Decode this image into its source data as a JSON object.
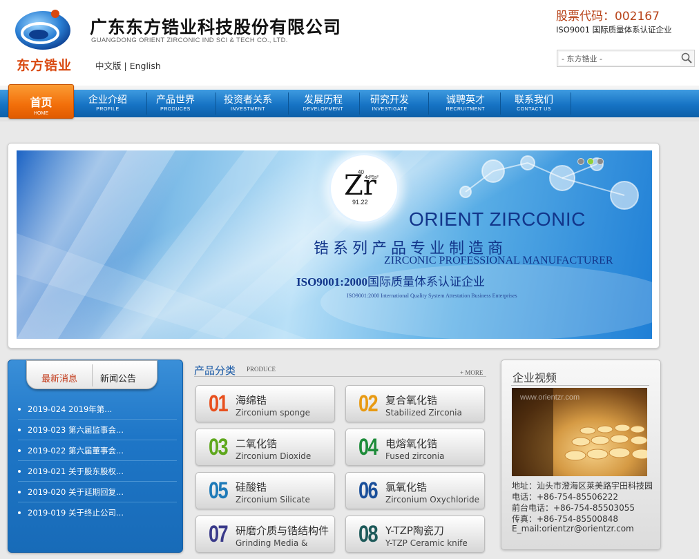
{
  "header": {
    "logo_text": "东方锆业",
    "company_name_cn": "广东东方锆业科技股份有限公司",
    "company_name_en": "GUANGDONG ORIENT ZIRCONIC IND SCI & TECH CO., LTD.",
    "lang_cn": "中文版",
    "lang_sep": "|",
    "lang_en": "English",
    "stock_code": "股票代码：002167",
    "iso_note": "ISO9001 国际质量体系认证企业",
    "search_placeholder": "- 东方锆业 -"
  },
  "nav": {
    "home": {
      "cn": "首页",
      "en": "HOME"
    },
    "items": [
      {
        "cn": "企业介绍",
        "en": "PROFILE"
      },
      {
        "cn": "产品世界",
        "en": "PRODUCES"
      },
      {
        "cn": "投资者关系",
        "en": "INVESTMENT"
      },
      {
        "cn": "发展历程",
        "en": "DEVELOPMENT"
      },
      {
        "cn": "研究开发",
        "en": "INVESTIGATE"
      },
      {
        "cn": "诚聘英才",
        "en": "RECRUITMENT"
      },
      {
        "cn": "联系我们",
        "en": "CONTACT US"
      }
    ]
  },
  "banner": {
    "element_number": "40",
    "element_config": "4d²5s²",
    "element_symbol": "Zr",
    "element_mass": "91.22",
    "brand_en": "ORIENT ZIRCONIC",
    "slogan_cn": "锆系列产品专业制造商",
    "slogan_en": "ZIRCONIC PROFESSIONAL MANUFACTURER",
    "iso_bold": "ISO9001:2000",
    "iso_cn": "国际质量体系认证企业",
    "iso_en": "ISO9001:2000 International Quality System Attestation Business Enterprises",
    "slide_dots": 3,
    "active_slide": 1
  },
  "news": {
    "tabs": [
      "最新消息",
      "新闻公告"
    ],
    "items": [
      "2019-024 2019年第...",
      "2019-023 第六届监事会...",
      "2019-022 第六届董事会...",
      "2019-021 关于股东股权...",
      "2019-020 关于延期回复...",
      "2019-019 关于终止公司..."
    ]
  },
  "products": {
    "title": "产品分类",
    "subtitle": "PRODUCE",
    "more": "+ MORE",
    "items": [
      {
        "num": "01",
        "cn": "海绵锆",
        "en": "Zirconium sponge",
        "color": "#e8501e"
      },
      {
        "num": "02",
        "cn": "复合氧化锆",
        "en": "Stabilized Zirconia",
        "color": "#e89a12"
      },
      {
        "num": "03",
        "cn": "二氧化锆",
        "en": "Zirconium Dioxide",
        "color": "#5fa81e"
      },
      {
        "num": "04",
        "cn": "电熔氧化锆",
        "en": "Fused zirconia",
        "color": "#1e8c3a"
      },
      {
        "num": "05",
        "cn": "硅酸锆",
        "en": "Zirconium Silicate",
        "color": "#1e7ab8"
      },
      {
        "num": "06",
        "cn": "氯氧化锆",
        "en": "Zirconium Oxychloride",
        "color": "#1a4f9a"
      },
      {
        "num": "07",
        "cn": "研磨介质与锆结构件",
        "en": "Grinding Media &",
        "color": "#3a3a8a"
      },
      {
        "num": "08",
        "cn": "Y-TZP陶瓷刀",
        "en": "Y-TZP Ceramic knife",
        "color": "#1e5a5a"
      }
    ]
  },
  "video": {
    "title": "企业视频",
    "watermark": "www.orientzr.com"
  },
  "contact": {
    "address": "地址：汕头市澄海区莱美路宇田科技园",
    "phone": "电话：+86-754-85506222",
    "front_desk": "前台电话：+86-754-85503055",
    "fax": "传真：+86-754-85500848",
    "email": "E_mail:orientzr@orientzr.com"
  },
  "colors": {
    "nav_blue": "#1673c4",
    "home_orange": "#f26f0a",
    "stock_red": "#b8441a",
    "brand_navy": "#12358a"
  }
}
